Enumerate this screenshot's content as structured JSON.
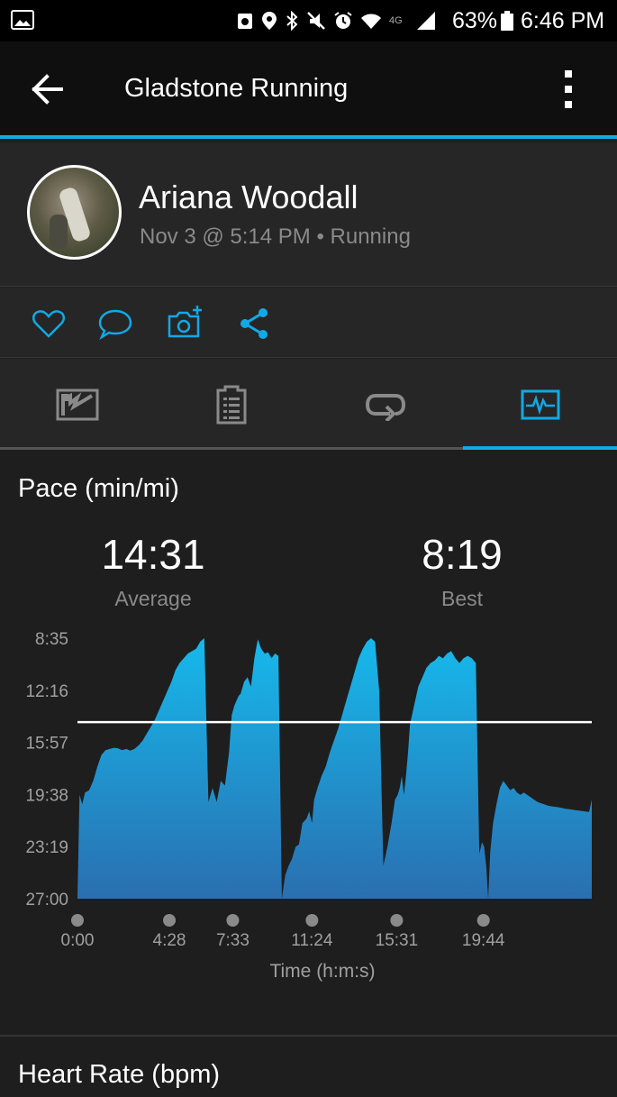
{
  "status_bar": {
    "battery_percent": "63%",
    "time": "6:46 PM",
    "network": "4G",
    "icons": [
      "image-icon",
      "auto-sync-icon",
      "location-icon",
      "bluetooth-icon",
      "mute-icon",
      "alarm-icon",
      "wifi-icon",
      "signal-icon",
      "battery-icon"
    ]
  },
  "app_bar": {
    "title": "Gladstone Running"
  },
  "activity": {
    "user_name": "Ariana Woodall",
    "meta": "Nov 3 @ 5:14 PM • Running"
  },
  "actions": [
    "like-icon",
    "comment-icon",
    "add-photo-icon",
    "share-icon"
  ],
  "tabs": [
    {
      "name": "map",
      "active": false
    },
    {
      "name": "details",
      "active": false
    },
    {
      "name": "laps",
      "active": false
    },
    {
      "name": "charts",
      "active": true
    }
  ],
  "pace": {
    "title": "Pace (min/mi)",
    "average_value": "14:31",
    "average_label": "Average",
    "best_value": "8:19",
    "best_label": "Best"
  },
  "heart_rate": {
    "title": "Heart Rate (bpm)"
  },
  "colors": {
    "accent": "#11a9e6",
    "fill_top": "#16b9ec",
    "fill_bottom": "#2a6fb0"
  },
  "chart_data": {
    "type": "area",
    "title": "Pace (min/mi)",
    "xlabel": "Time (h:m:s)",
    "ylabel": "",
    "y_ticks": [
      "8:35",
      "12:16",
      "15:57",
      "19:38",
      "23:19",
      "27:00"
    ],
    "y_tick_seconds": [
      515,
      736,
      957,
      1178,
      1399,
      1620
    ],
    "y_inverted": true,
    "x_ticks": [
      "0:00",
      "4:28",
      "7:33",
      "11:24",
      "15:31",
      "19:44"
    ],
    "x_tick_seconds": [
      0,
      268,
      453,
      684,
      931,
      1184
    ],
    "x_max_seconds": 1500,
    "average_line": "14:31",
    "average_line_seconds": 871,
    "x": [
      0,
      6,
      14,
      22,
      34,
      46,
      58,
      70,
      82,
      94,
      106,
      118,
      130,
      142,
      154,
      166,
      178,
      190,
      202,
      214,
      226,
      238,
      250,
      262,
      274,
      286,
      298,
      310,
      322,
      334,
      346,
      358,
      370,
      382,
      394,
      406,
      418,
      430,
      442,
      450,
      458,
      464,
      470,
      476,
      486,
      496,
      506,
      516,
      526,
      536,
      546,
      556,
      566,
      576,
      586,
      596,
      606,
      616,
      626,
      636,
      646,
      656,
      668,
      676,
      684,
      690,
      700,
      712,
      724,
      736,
      748,
      760,
      772,
      784,
      796,
      808,
      820,
      832,
      844,
      856,
      868,
      880,
      892,
      904,
      916,
      926,
      934,
      940,
      946,
      952,
      958,
      964,
      970,
      976,
      982,
      988,
      994,
      1006,
      1018,
      1030,
      1042,
      1054,
      1066,
      1078,
      1090,
      1102,
      1114,
      1126,
      1138,
      1150,
      1162,
      1172,
      1180,
      1186,
      1192,
      1198,
      1204,
      1212,
      1222,
      1232,
      1242,
      1252,
      1262,
      1272,
      1282,
      1292,
      1302,
      1312,
      1322,
      1332,
      1342,
      1352,
      1362,
      1372,
      1382,
      1392,
      1402,
      1412,
      1422,
      1432,
      1442,
      1452,
      1462,
      1472,
      1482,
      1492,
      1500
    ],
    "pace_seconds": [
      1620,
      1180,
      1220,
      1170,
      1160,
      1120,
      1060,
      1010,
      990,
      985,
      980,
      982,
      990,
      985,
      992,
      985,
      970,
      950,
      920,
      890,
      860,
      820,
      780,
      740,
      700,
      650,
      620,
      600,
      580,
      570,
      560,
      530,
      515,
      1210,
      1150,
      1210,
      1120,
      1140,
      1000,
      840,
      800,
      780,
      760,
      750,
      700,
      680,
      720,
      600,
      520,
      560,
      580,
      575,
      600,
      580,
      590,
      1620,
      1520,
      1480,
      1450,
      1400,
      1390,
      1300,
      1280,
      1250,
      1300,
      1200,
      1150,
      1100,
      1060,
      1000,
      950,
      900,
      840,
      780,
      720,
      660,
      600,
      560,
      530,
      515,
      530,
      740,
      1480,
      1400,
      1300,
      1200,
      1180,
      1150,
      1100,
      1180,
      1100,
      1000,
      880,
      840,
      800,
      760,
      720,
      680,
      640,
      620,
      610,
      590,
      600,
      580,
      570,
      600,
      620,
      600,
      590,
      600,
      620,
      1430,
      1380,
      1400,
      1480,
      1620,
      1420,
      1300,
      1220,
      1150,
      1120,
      1140,
      1160,
      1150,
      1170,
      1180,
      1170,
      1180,
      1190,
      1200,
      1210,
      1215,
      1220,
      1225,
      1228,
      1230,
      1232,
      1235,
      1238,
      1240,
      1242,
      1244,
      1246,
      1248,
      1250,
      1252,
      1200
    ]
  }
}
